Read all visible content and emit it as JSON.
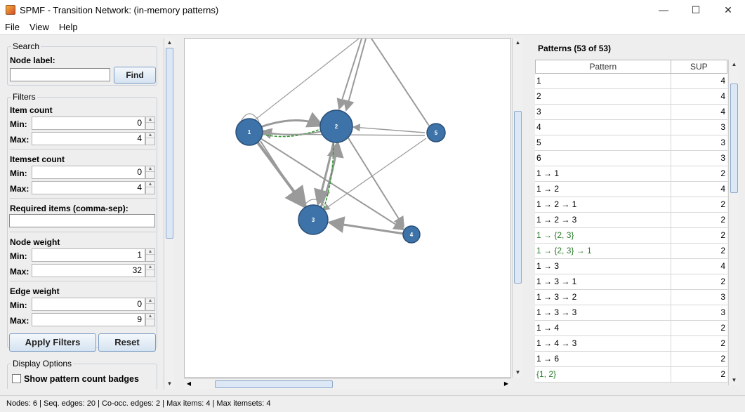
{
  "window": {
    "title": "SPMF - Transition Network: (in-memory patterns)"
  },
  "menu": [
    "File",
    "View",
    "Help"
  ],
  "search": {
    "group_title": "Search",
    "node_label": "Node label:",
    "value": "",
    "find_label": "Find"
  },
  "filters": {
    "group_title": "Filters",
    "item_count": {
      "label": "Item count",
      "min_label": "Min:",
      "min": "0",
      "max_label": "Max:",
      "max": "4"
    },
    "itemset_count": {
      "label": "Itemset count",
      "min_label": "Min:",
      "min": "0",
      "max_label": "Max:",
      "max": "4"
    },
    "required_items": {
      "label": "Required items (comma-sep):",
      "value": ""
    },
    "node_weight": {
      "label": "Node weight",
      "min_label": "Min:",
      "min": "1",
      "max_label": "Max:",
      "max": "32"
    },
    "edge_weight": {
      "label": "Edge weight",
      "min_label": "Min:",
      "min": "0",
      "max_label": "Max:",
      "max": "9"
    },
    "apply_label": "Apply Filters",
    "reset_label": "Reset"
  },
  "display_options": {
    "group_title": "Display Options",
    "badges_label": "Show pattern count badges",
    "badges_checked": false
  },
  "graph": {
    "nodes": [
      "1",
      "2",
      "3",
      "4",
      "5"
    ],
    "node_color": "#3d73a8",
    "edge_color": "#9a9a9a",
    "highlight_edge_color": "#3a9a3a"
  },
  "patterns": {
    "header": "Patterns (53 of 53)",
    "columns": [
      "Pattern",
      "SUP"
    ],
    "rows": [
      {
        "pattern": "1",
        "sup": "4",
        "green": false
      },
      {
        "pattern": "2",
        "sup": "4",
        "green": false
      },
      {
        "pattern": "3",
        "sup": "4",
        "green": false
      },
      {
        "pattern": "4",
        "sup": "3",
        "green": false
      },
      {
        "pattern": "5",
        "sup": "3",
        "green": false
      },
      {
        "pattern": "6",
        "sup": "3",
        "green": false
      },
      {
        "pattern": "1 → 1",
        "sup": "2",
        "green": false
      },
      {
        "pattern": "1 → 2",
        "sup": "4",
        "green": false
      },
      {
        "pattern": "1 → 2 → 1",
        "sup": "2",
        "green": false
      },
      {
        "pattern": "1 → 2 → 3",
        "sup": "2",
        "green": false
      },
      {
        "pattern": "1 → {2, 3}",
        "sup": "2",
        "green": true
      },
      {
        "pattern": "1 → {2, 3} → 1",
        "sup": "2",
        "green": true
      },
      {
        "pattern": "1 → 3",
        "sup": "4",
        "green": false
      },
      {
        "pattern": "1 → 3 → 1",
        "sup": "2",
        "green": false
      },
      {
        "pattern": "1 → 3 → 2",
        "sup": "3",
        "green": false
      },
      {
        "pattern": "1 → 3 → 3",
        "sup": "3",
        "green": false
      },
      {
        "pattern": "1 → 4",
        "sup": "2",
        "green": false
      },
      {
        "pattern": "1 → 4 → 3",
        "sup": "2",
        "green": false
      },
      {
        "pattern": "1 → 6",
        "sup": "2",
        "green": false
      },
      {
        "pattern": "{1, 2}",
        "sup": "2",
        "green": true
      }
    ]
  },
  "status": "Nodes: 6 | Seq. edges: 20 | Co-occ. edges: 2 | Max items: 4 | Max itemsets: 4"
}
